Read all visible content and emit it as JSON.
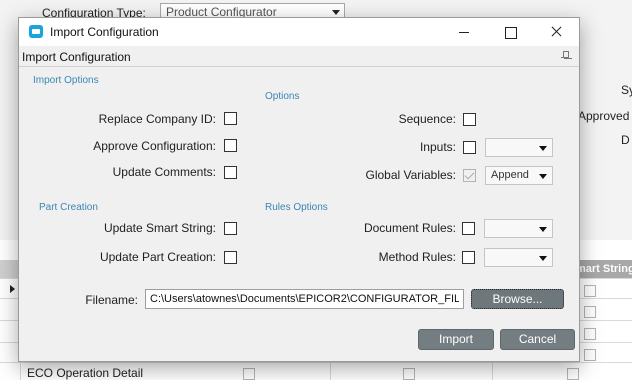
{
  "background": {
    "configuration_type_label": "Configuration Type:",
    "configuration_type_value": "Product Configurator",
    "right_fragments": [
      "Sy",
      "Approved",
      "D"
    ],
    "grid_header_fragment": "mart String",
    "last_row_label": "ECO Operation Detail"
  },
  "dialog": {
    "window_title": "Import Configuration",
    "panel_title": "Import Configuration",
    "sections": {
      "import_options": "Import Options",
      "options": "Options",
      "part_creation": "Part Creation",
      "rules_options": "Rules Options"
    },
    "import_options": {
      "replace_company_id": {
        "label": "Replace Company ID:",
        "checked": false
      },
      "approve_configuration": {
        "label": "Approve Configuration:",
        "checked": false
      },
      "update_comments": {
        "label": "Update Comments:",
        "checked": false
      }
    },
    "options": {
      "sequence": {
        "label": "Sequence:",
        "checked": false
      },
      "inputs": {
        "label": "Inputs:",
        "checked": false,
        "dropdown_value": ""
      },
      "global_variables": {
        "label": "Global Variables:",
        "checked": true,
        "dropdown_value": "Append"
      }
    },
    "part_creation": {
      "update_smart_string": {
        "label": "Update Smart String:",
        "checked": false
      },
      "update_part_creation": {
        "label": "Update Part Creation:",
        "checked": false
      }
    },
    "rules_options": {
      "document_rules": {
        "label": "Document Rules:",
        "checked": false,
        "dropdown_value": ""
      },
      "method_rules": {
        "label": "Method Rules:",
        "checked": false,
        "dropdown_value": ""
      }
    },
    "filename": {
      "label": "Filename:",
      "value": "C:\\Users\\atownes\\Documents\\EPICOR2\\CONFIGURATOR_FIL"
    },
    "buttons": {
      "browse": "Browse...",
      "import": "Import",
      "cancel": "Cancel"
    }
  },
  "colors": {
    "section_header": "#3c85b3",
    "button_bg": "#747d82",
    "app_icon": "#1aa3dc"
  }
}
